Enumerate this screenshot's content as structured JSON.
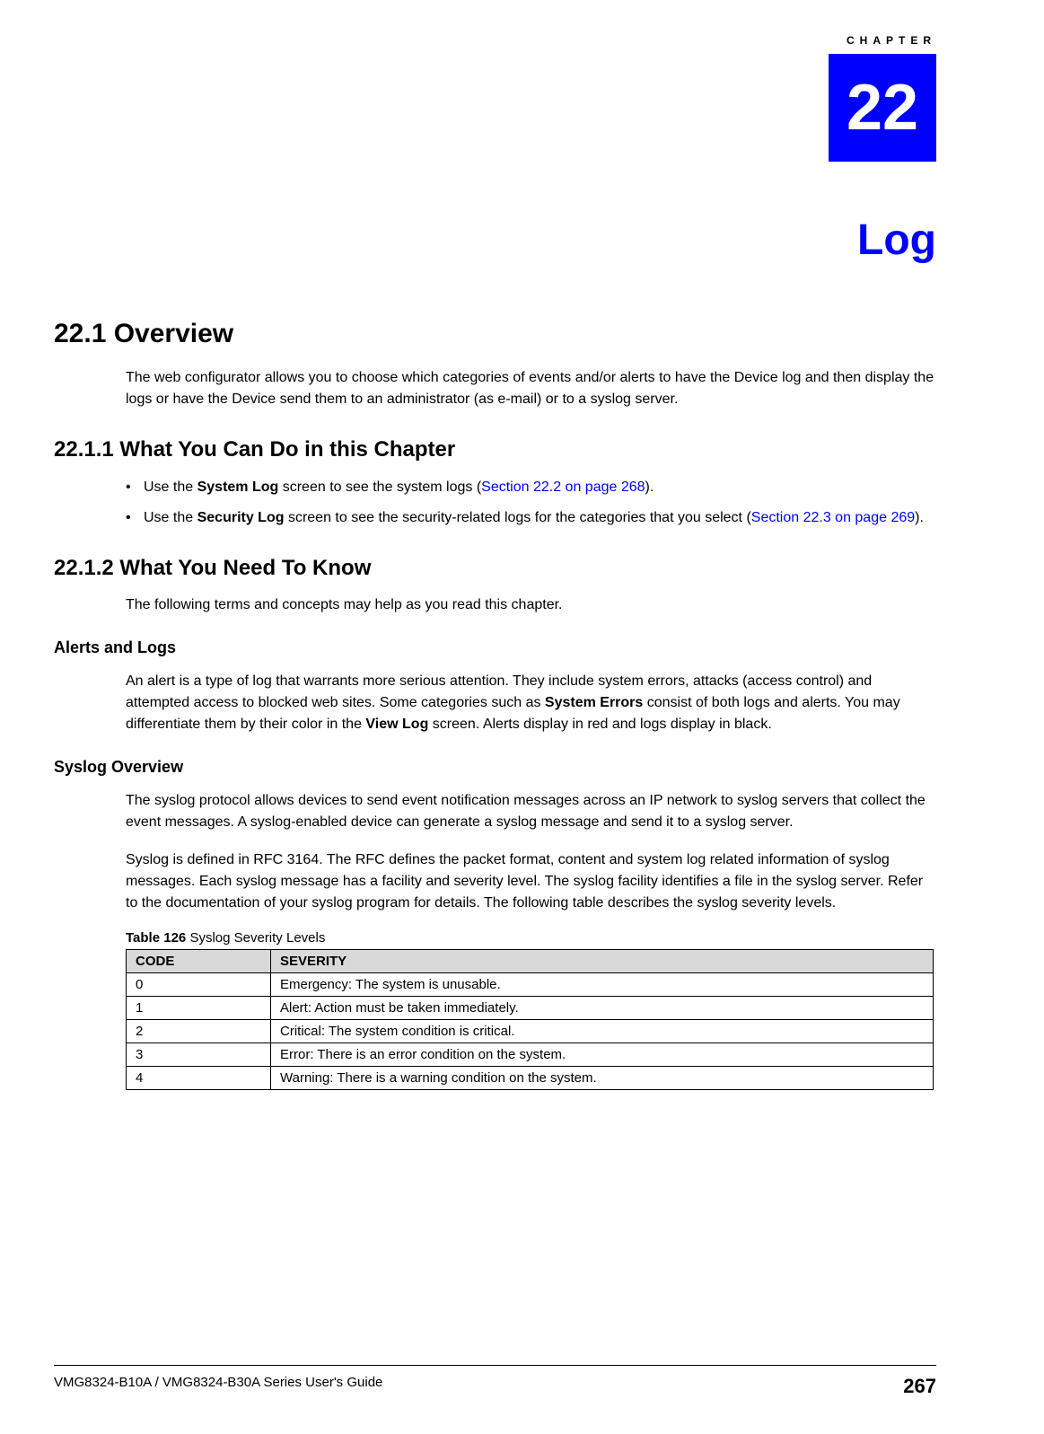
{
  "chapter": {
    "prefix": "CHAPTER",
    "number": "22",
    "title": "Log"
  },
  "overview": {
    "heading": "22.1  Overview",
    "paragraph": "The web configurator allows you to choose which categories of events and/or alerts to have the Device log and then display the logs or have the Device send them to an administrator (as e-mail) or to a syslog server."
  },
  "what_you_can_do": {
    "heading": "22.1.1  What You Can Do in this Chapter",
    "bullets": [
      {
        "pre": "Use the ",
        "bold1": "System Log",
        "mid": " screen to see the system logs (",
        "link": "Section 22.2 on page 268",
        "post": ")."
      },
      {
        "pre": "Use the ",
        "bold1": "Security Log",
        "mid": " screen to see the security-related logs for the categories that you select (",
        "link": "Section 22.3 on page 269",
        "post": ")."
      }
    ]
  },
  "need_to_know": {
    "heading": "22.1.2  What You Need To Know",
    "paragraph": "The following terms and concepts may help as you read this chapter."
  },
  "alerts_and_logs": {
    "heading": "Alerts and Logs",
    "para_pre": "An alert is a type of log that warrants more serious attention. They include system errors, attacks (access control) and attempted access to blocked web sites. Some categories such as ",
    "para_bold1": "System Errors",
    "para_mid1": " consist of both logs and alerts. You may differentiate them by their color in the ",
    "para_bold2": "View Log",
    "para_post": " screen. Alerts display in red and logs display in black."
  },
  "syslog_overview": {
    "heading": "Syslog Overview",
    "para1": "The syslog protocol allows devices to send event notification messages across an IP network to syslog servers that collect the event messages. A syslog-enabled device can generate a syslog message and send it to a syslog server.",
    "para2": "Syslog is defined in RFC 3164. The RFC defines the packet format, content and system log related information of syslog messages. Each syslog message has a facility and severity level. The syslog facility identifies a file in the syslog server. Refer to the documentation of your syslog program for details. The following table describes the syslog severity levels."
  },
  "table": {
    "caption_pre": "Table 126 ",
    "caption_main": "  Syslog Severity Levels",
    "headers": [
      "CODE",
      "SEVERITY"
    ],
    "rows": [
      {
        "code": "0",
        "severity": "Emergency: The system is unusable."
      },
      {
        "code": "1",
        "severity": "Alert: Action must be taken immediately."
      },
      {
        "code": "2",
        "severity": "Critical: The system condition is critical."
      },
      {
        "code": "3",
        "severity": "Error: There is an error condition on the system."
      },
      {
        "code": "4",
        "severity": "Warning: There is a warning condition on the system."
      }
    ]
  },
  "footer": {
    "guide": "VMG8324-B10A / VMG8324-B30A Series User's Guide",
    "page": "267"
  }
}
